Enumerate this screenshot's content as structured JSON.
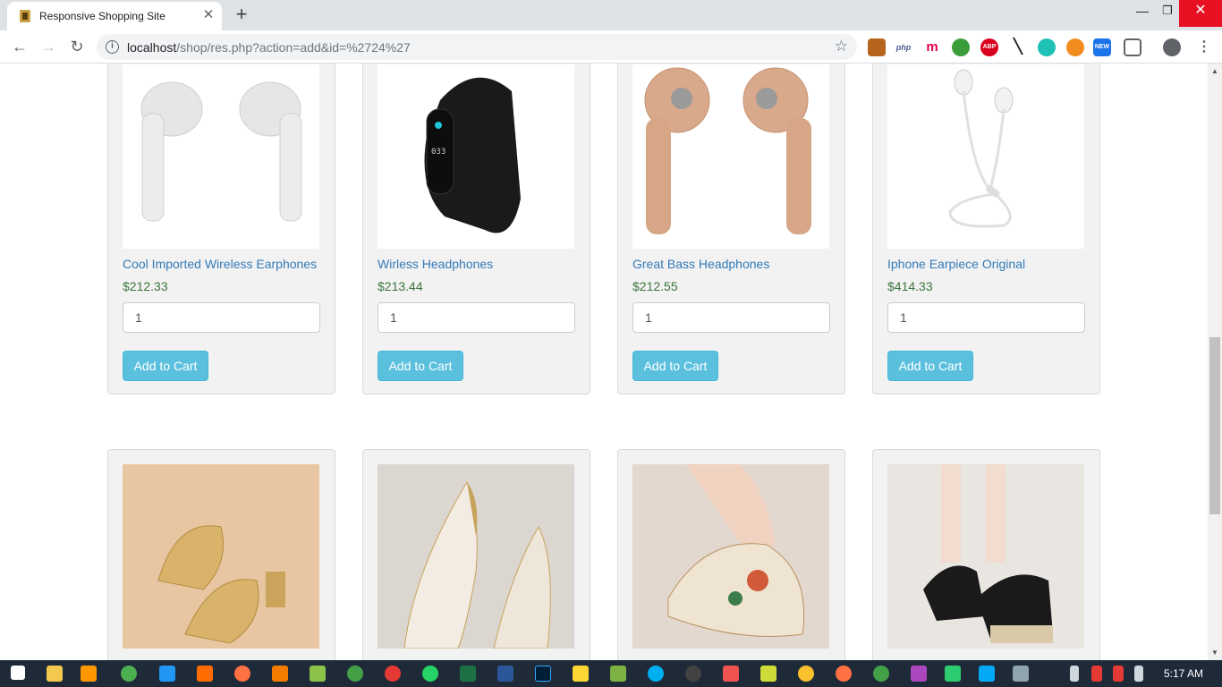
{
  "browser": {
    "tab_title": "Responsive Shopping Site",
    "tab_close": "✕",
    "new_tab": "+",
    "url_host": "localhost",
    "url_path": "/shop/res.php?action=add&id=%2724%27",
    "win_min": "—",
    "win_max": "❐",
    "win_close": "✕",
    "nav_back": "←",
    "nav_forward": "→",
    "nav_reload": "↻",
    "star": "☆",
    "extensions": [
      "php",
      "m",
      "ABP",
      "NEW"
    ]
  },
  "products": [
    {
      "name": "Cool Imported Wireless Earphones",
      "price": "$212.33",
      "qty": "1",
      "button": "Add to Cart",
      "image": "white-earbuds"
    },
    {
      "name": "Wirless Headphones",
      "price": "$213.44",
      "qty": "1",
      "button": "Add to Cart",
      "image": "black-fitness-band"
    },
    {
      "name": "Great Bass Headphones",
      "price": "$212.55",
      "qty": "1",
      "button": "Add to Cart",
      "image": "gold-earbuds"
    },
    {
      "name": "Iphone Earpiece Original",
      "price": "$414.33",
      "qty": "1",
      "button": "Add to Cart",
      "image": "wired-earphones"
    }
  ],
  "second_row_images": [
    "gold-sandals",
    "pointed-flats",
    "floral-loafers",
    "black-wedges"
  ],
  "taskbar": {
    "time": "5:17 AM"
  },
  "colors": {
    "link": "#337ab7",
    "price": "#3c763d",
    "button": "#5bc0de",
    "card_bg": "#f2f2f2"
  }
}
